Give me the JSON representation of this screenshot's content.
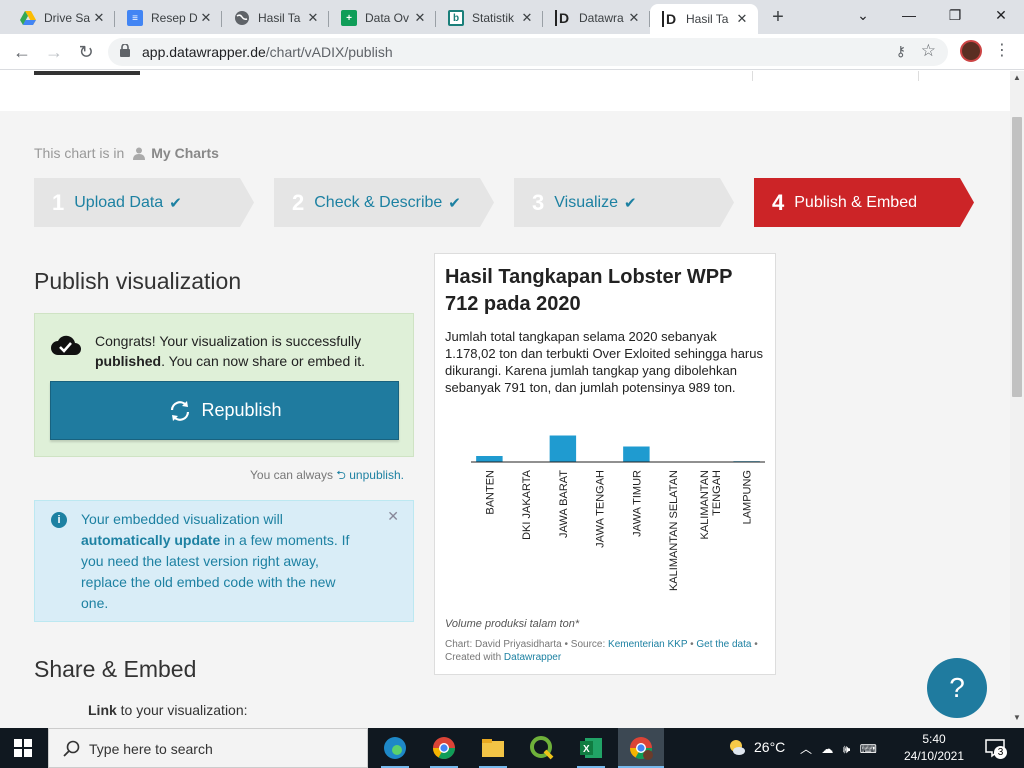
{
  "browser": {
    "tabs": [
      {
        "label": "Drive Sa",
        "icon": "google-drive-icon",
        "color": "#34a853"
      },
      {
        "label": "Resep D",
        "icon": "google-docs-icon",
        "color": "#4285f4"
      },
      {
        "label": "Hasil Ta",
        "icon": "globe-icon",
        "color": "#5f6368"
      },
      {
        "label": "Data Ov",
        "icon": "google-sheets-icon",
        "color": "#0f9d58"
      },
      {
        "label": "Statistik",
        "icon": "statistik-icon",
        "color": "#1a7f7a"
      },
      {
        "label": "Datawra",
        "icon": "datawrapper-icon",
        "color": "#222222"
      },
      {
        "label": "Hasil Ta",
        "icon": "datawrapper-icon",
        "color": "#222222"
      }
    ],
    "url_host": "app.datawrapper.de",
    "url_path": "/chart/vADIX/publish"
  },
  "page": {
    "crumb_prefix": "This chart is in",
    "crumb_folder": "My Charts",
    "steps": [
      {
        "num": "1",
        "label": "Upload Data",
        "check": "✔"
      },
      {
        "num": "2",
        "label": "Check & Describe",
        "check": "✔"
      },
      {
        "num": "3",
        "label": "Visualize",
        "check": "✔"
      },
      {
        "num": "4",
        "label": "Publish & Embed",
        "check": ""
      }
    ],
    "publish_heading": "Publish visualization",
    "success": {
      "line1": "Congrats! Your visualization is successfully ",
      "bold": "published",
      "line2": ". You can now share or embed it."
    },
    "republish_label": "Republish",
    "unpublish_prefix": "You can always",
    "unpublish_link": "unpublish.",
    "info": {
      "t1": "Your embedded visualization will ",
      "b1": "automatically update",
      "t2": " in a few moments. If you need the latest version right away, replace the old embed code with the new one."
    },
    "share_heading": "Share & Embed",
    "link_label_bold": "Link",
    "link_label_rest": " to your visualization:",
    "help_label": "?"
  },
  "chart": {
    "title": "Hasil Tangkapan Lobster WPP 712 pada 2020",
    "description": "Jumlah total tangkapan selama 2020 sebanyak 1.178,02 ton dan terbukti Over Exloited sehingga harus dikurangi. Karena jumlah tangkap yang dibolehkan sebanyak 791 ton, dan jumlah potensinya 989 ton.",
    "note": "Volume produksi talam ton*",
    "footer": {
      "chart_by": "Chart: David Priyasidharta",
      "source_prefix": "Source:",
      "source": "Kementerian KKP",
      "get_data": "Get the data",
      "created_prefix": "Created with",
      "created": "Datawrapper"
    },
    "bar_color": "#1f9bd0"
  },
  "chart_data": {
    "type": "bar",
    "categories": [
      "BANTEN",
      "DKI JAKARTA",
      "JAWA BARAT",
      "JAWA TENGAH",
      "JAWA TIMUR",
      "KALIMANTAN SELATAN",
      "KALIMANTAN TENGAH",
      "LAMPUNG"
    ],
    "values": [
      60,
      0,
      265,
      0,
      155,
      0,
      0,
      8
    ],
    "title": "Hasil Tangkapan Lobster WPP 712 pada 2020",
    "xlabel": "",
    "ylabel": "",
    "ylim": [
      0,
      300
    ],
    "grid": false,
    "legend": "none"
  },
  "taskbar": {
    "search_placeholder": "Type here to search",
    "temperature": "26°C",
    "time": "5:40",
    "date": "24/10/2021",
    "notifications": "3"
  }
}
